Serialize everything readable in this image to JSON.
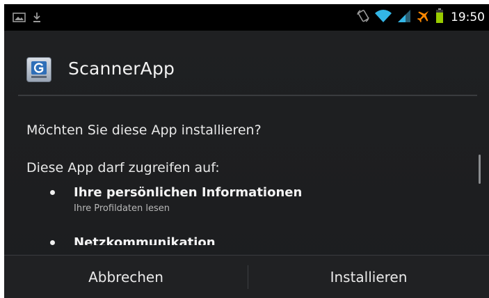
{
  "status_bar": {
    "time": "19:50",
    "icons_left": [
      "gallery-notification-icon",
      "download-icon"
    ],
    "icons_right": [
      "auto-rotate-icon",
      "wifi-icon",
      "signal-icon",
      "airplane-mode-icon",
      "battery-icon"
    ]
  },
  "dialog": {
    "app_name": "ScannerApp",
    "question": "Möchten Sie diese App installieren?",
    "permissions_header": "Diese App darf zugreifen auf:",
    "permissions": [
      {
        "title": "Ihre persönlichen Informationen",
        "subtitle": "Ihre Profildaten lesen"
      },
      {
        "title": "Netzkommunikation",
        "subtitle": ""
      }
    ]
  },
  "buttons": {
    "cancel_label": "Abbrechen",
    "install_label": "Installieren"
  },
  "colors": {
    "background": "#1e1f21",
    "status_bar": "#000000",
    "wifi": "#33b5e5",
    "signal": "#33b5e5",
    "airplane": "#ff8800",
    "battery": "#99cc00"
  }
}
